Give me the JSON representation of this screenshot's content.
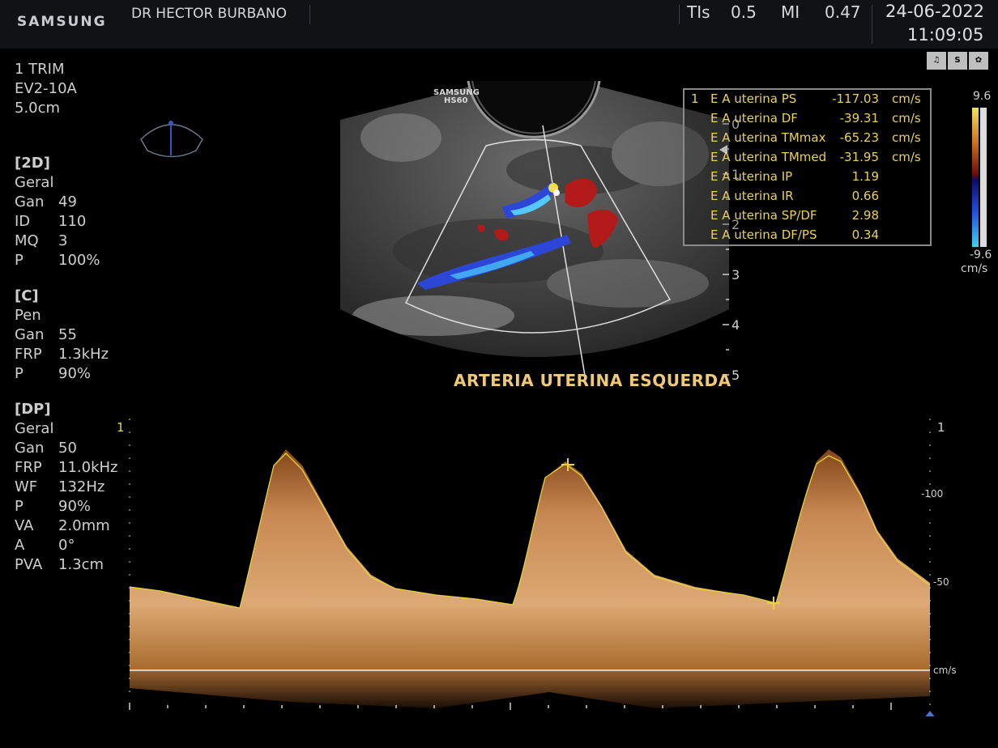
{
  "header": {
    "brand": "SAMSUNG",
    "doctor": "DR HECTOR BURBANO",
    "tis_label": "TIs",
    "tis_value": "0.5",
    "mi_label": "MI",
    "mi_value": "0.47",
    "date": "24-06-2022",
    "time": "11:09:05"
  },
  "exam": {
    "preset": "1 TRIM",
    "probe": "EV2-10A",
    "depth": "5.0cm"
  },
  "mode_2d": {
    "title": "[2D]",
    "mode": "Geral",
    "params": [
      {
        "k": "Gan",
        "v": "49"
      },
      {
        "k": "ID",
        "v": "110"
      },
      {
        "k": "MQ",
        "v": "3"
      },
      {
        "k": "P",
        "v": "100%"
      }
    ]
  },
  "mode_c": {
    "title": "[C]",
    "mode": "Pen",
    "params": [
      {
        "k": "Gan",
        "v": "55"
      },
      {
        "k": "FRP",
        "v": "1.3kHz"
      },
      {
        "k": "P",
        "v": "90%"
      }
    ]
  },
  "mode_dp": {
    "title": "[DP]",
    "mode": "Geral",
    "params": [
      {
        "k": "Gan",
        "v": "50"
      },
      {
        "k": "FRP",
        "v": "11.0kHz"
      },
      {
        "k": "WF",
        "v": "132Hz"
      },
      {
        "k": "P",
        "v": "90%"
      },
      {
        "k": "VA",
        "v": "2.0mm"
      },
      {
        "k": "A",
        "v": "0°"
      },
      {
        "k": "PVA",
        "v": "1.3cm"
      }
    ]
  },
  "image_watermark": {
    "line1": "SAMSUNG",
    "line2": "HS60"
  },
  "corner_icons": [
    "bell-icon",
    "S HAR",
    "film-reel-icon"
  ],
  "measurements": {
    "index": "1",
    "rows": [
      {
        "label": "E A uterina PS",
        "value": "-117.03",
        "unit": "cm/s"
      },
      {
        "label": "E A uterina DF",
        "value": "-39.31",
        "unit": "cm/s"
      },
      {
        "label": "E A uterina TMmax",
        "value": "-65.23",
        "unit": "cm/s"
      },
      {
        "label": "E A uterina TMmed",
        "value": "-31.95",
        "unit": "cm/s"
      },
      {
        "label": "E A uterina IP",
        "value": "1.19",
        "unit": ""
      },
      {
        "label": "E A uterina IR",
        "value": "0.66",
        "unit": ""
      },
      {
        "label": "E A uterina SP/DF",
        "value": "2.98",
        "unit": ""
      },
      {
        "label": "E A uterina DF/PS",
        "value": "0.34",
        "unit": ""
      }
    ]
  },
  "color_bar": {
    "max": "9.6",
    "min": "-9.6",
    "unit": "cm/s"
  },
  "depth_scale": [
    "0",
    "1",
    "2",
    "3",
    "4",
    "5"
  ],
  "caption": "ARTERIA UTERINA ESQUERDA",
  "spectral": {
    "left_marker": "1",
    "right_marker": "1",
    "scale_100": "-100",
    "scale_50": "-50",
    "unit": "cm/s"
  },
  "colors": {
    "measurement_text": "#e8d25a",
    "caption": "#f0c879",
    "doppler_fill": "#e0a05a"
  }
}
